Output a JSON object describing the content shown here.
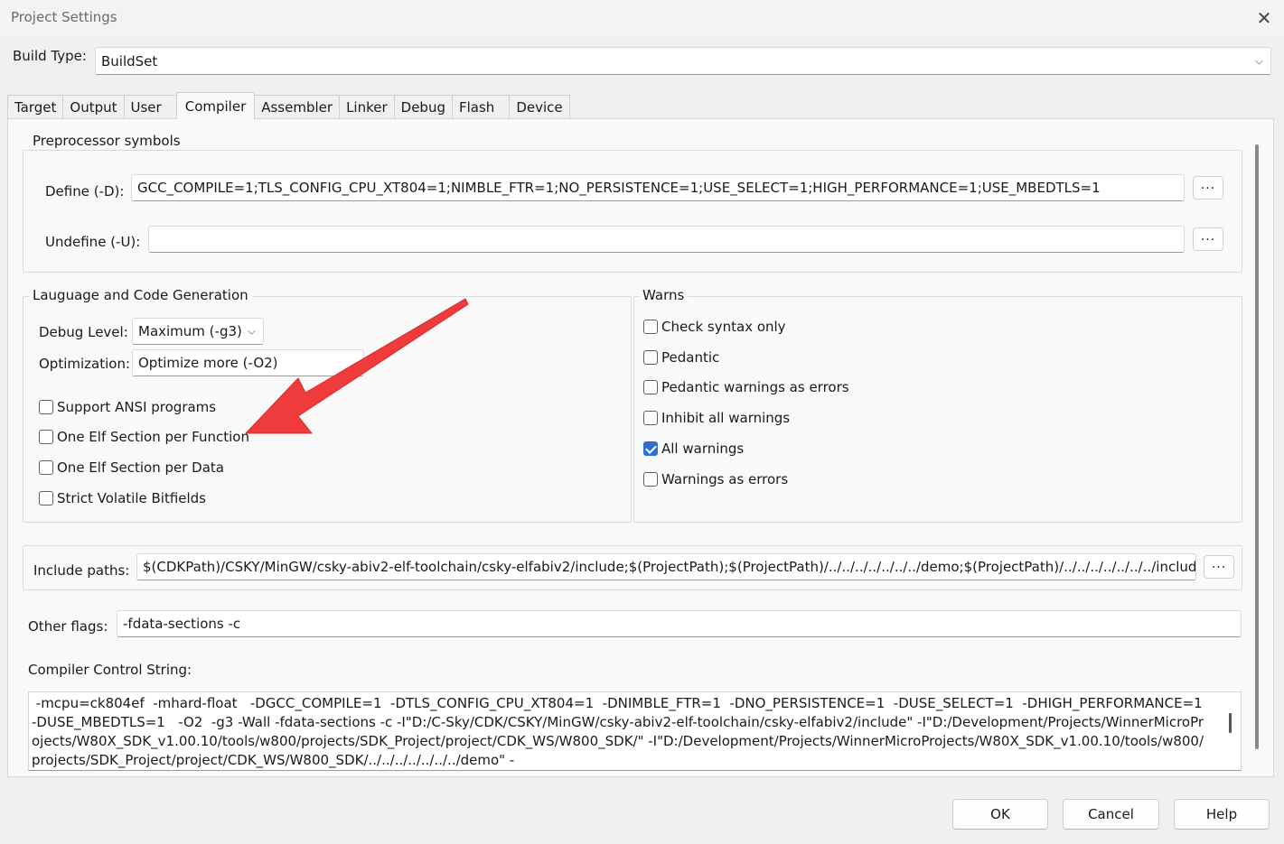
{
  "window": {
    "title": "Project Settings"
  },
  "build_type": {
    "label": "Build Type:",
    "value": "BuildSet"
  },
  "tabs": [
    "Target",
    "Output",
    "User",
    "Compiler",
    "Assembler",
    "Linker",
    "Debug",
    "Flash",
    "Device"
  ],
  "active_tab": "Compiler",
  "preprocessor": {
    "title": "Preprocessor symbols",
    "define_label": "Define (-D):",
    "define_value": "GCC_COMPILE=1;TLS_CONFIG_CPU_XT804=1;NIMBLE_FTR=1;NO_PERSISTENCE=1;USE_SELECT=1;HIGH_PERFORMANCE=1;USE_MBEDTLS=1",
    "undefine_label": "Undefine (-U):",
    "undefine_value": "",
    "browse_label": "..."
  },
  "language": {
    "title": "Lauguage and Code Generation",
    "debug_level_label": "Debug Level:",
    "debug_level_value": "Maximum (-g3)",
    "optimization_label": "Optimization:",
    "optimization_value": "Optimize more (-O2)",
    "options": [
      {
        "label": "Support ANSI programs",
        "checked": false
      },
      {
        "label": "One Elf Section per Function",
        "checked": false
      },
      {
        "label": "One Elf Section per Data",
        "checked": false
      },
      {
        "label": "Strict Volatile Bitfields",
        "checked": false
      }
    ]
  },
  "warns": {
    "title": "Warns",
    "options": [
      {
        "label": "Check syntax only",
        "checked": false
      },
      {
        "label": "Pedantic",
        "checked": false
      },
      {
        "label": "Pedantic warnings as errors",
        "checked": false
      },
      {
        "label": "Inhibit all warnings",
        "checked": false
      },
      {
        "label": "All warnings",
        "checked": true
      },
      {
        "label": "Warnings as errors",
        "checked": false
      }
    ]
  },
  "include_paths": {
    "label": "Include paths:",
    "value": "$(CDKPath)/CSKY/MinGW/csky-abiv2-elf-toolchain/csky-elfabiv2/include;$(ProjectPath);$(ProjectPath)/../../../../../../../demo;$(ProjectPath)/../../../../../../../include;$(Pr",
    "browse_label": "..."
  },
  "other_flags": {
    "label": "Other flags:",
    "value": "-fdata-sections -c"
  },
  "control_string": {
    "label": "Compiler Control String:",
    "value": " -mcpu=ck804ef  -mhard-float   -DGCC_COMPILE=1  -DTLS_CONFIG_CPU_XT804=1  -DNIMBLE_FTR=1  -DNO_PERSISTENCE=1  -DUSE_SELECT=1  -DHIGH_PERFORMANCE=1  -DUSE_MBEDTLS=1   -O2  -g3 -Wall -fdata-sections -c -I\"D:/C-Sky/CDK/CSKY/MinGW/csky-abiv2-elf-toolchain/csky-elfabiv2/include\" -I\"D:/Development/Projects/WinnerMicroProjects/W80X_SDK_v1.00.10/tools/w800/projects/SDK_Project/project/CDK_WS/W800_SDK/\" -I\"D:/Development/Projects/WinnerMicroProjects/W80X_SDK_v1.00.10/tools/w800/projects/SDK_Project/project/CDK_WS/W800_SDK/../../../../../../../demo\" -"
  },
  "buttons": {
    "ok": "OK",
    "cancel": "Cancel",
    "help": "Help"
  },
  "icons": {
    "close": "close-icon",
    "dropdown": "chevron-down-icon",
    "annotation": "red-arrow-annotation"
  },
  "colors": {
    "accent": "#2f6fd1",
    "annotation": "#ef3b3b"
  }
}
